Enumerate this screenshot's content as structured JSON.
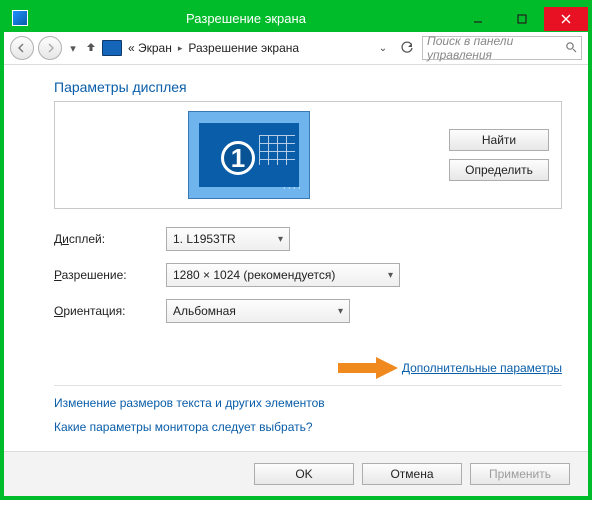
{
  "window": {
    "title": "Разрешение экрана"
  },
  "nav": {
    "back_icon": "arrow-left",
    "forward_icon": "arrow-right",
    "up_icon": "arrow-up",
    "crumbs": {
      "root": "« Экран",
      "current": "Разрешение экрана"
    },
    "refresh_icon": "refresh",
    "search_placeholder": "Поиск в панели управления"
  },
  "section_title": "Параметры дисплея",
  "preview": {
    "monitor_number": "1"
  },
  "buttons": {
    "find": "Найти",
    "identify": "Определить"
  },
  "form": {
    "display": {
      "label_pre": "Д",
      "label_ul": "и",
      "label_post": "сплей:",
      "value": "1. L1953TR"
    },
    "resolution": {
      "label_pre": "",
      "label_ul": "Р",
      "label_post": "азрешение:",
      "value": "1280 × 1024 (рекомендуется)"
    },
    "orientation": {
      "label_pre": "",
      "label_ul": "О",
      "label_post": "риентация:",
      "value": "Альбомная"
    }
  },
  "links": {
    "advanced": "Дополнительные параметры",
    "text_size": "Изменение размеров текста и других элементов",
    "which_settings": "Какие параметры монитора следует выбрать?"
  },
  "footer": {
    "ok": "OK",
    "cancel": "Отмена",
    "apply": "Применить"
  }
}
